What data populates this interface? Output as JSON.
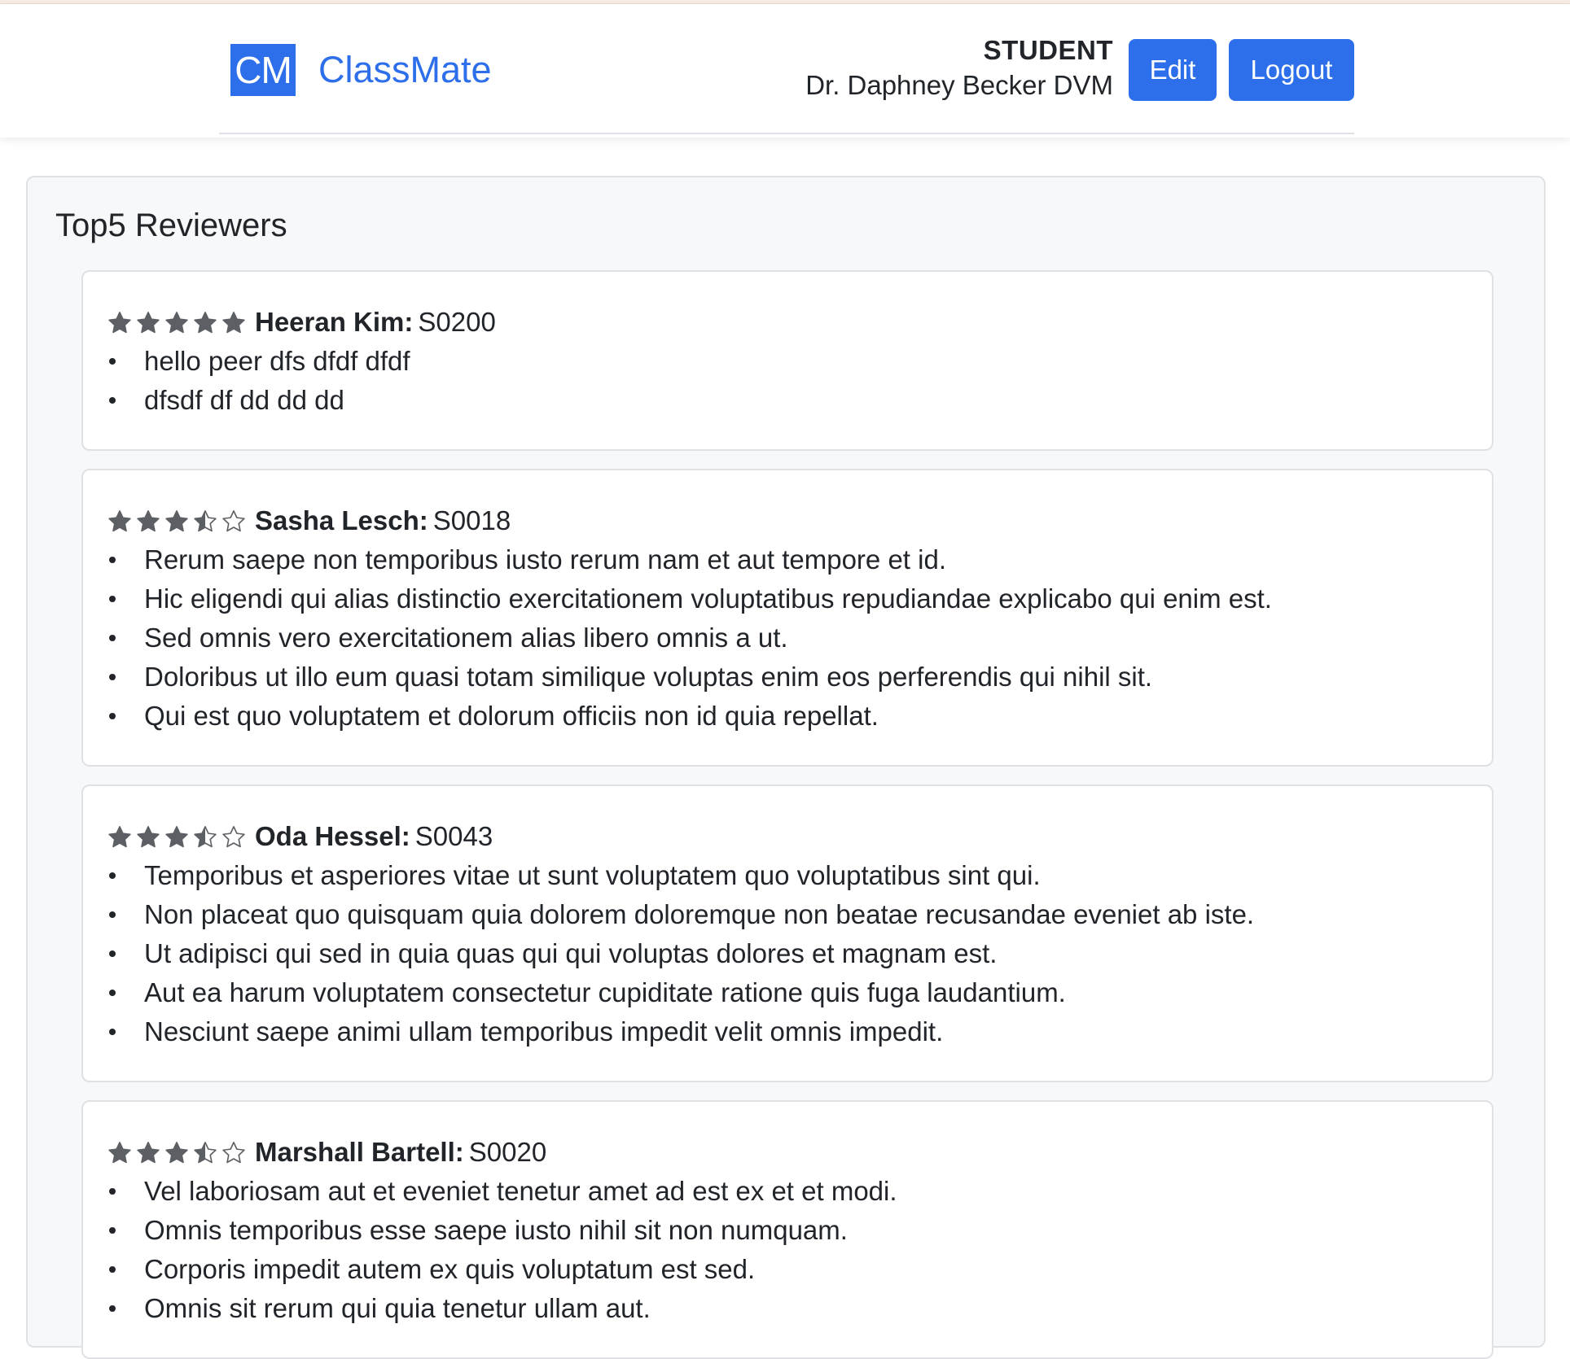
{
  "brand": {
    "logo": "CM",
    "name": "ClassMate"
  },
  "user": {
    "role": "STUDENT",
    "name": "Dr. Daphney Becker DVM"
  },
  "buttons": {
    "edit": "Edit",
    "logout": "Logout"
  },
  "colors": {
    "primary": "#2d6eea",
    "star": "#5c5f63"
  },
  "panel": {
    "title": "Top5 Reviewers"
  },
  "reviewers": [
    {
      "name": "Heeran Kim:",
      "id": "S0200",
      "rating": 5,
      "comments": [
        "hello peer dfs dfdf dfdf",
        "dfsdf df dd dd dd"
      ]
    },
    {
      "name": "Sasha Lesch:",
      "id": "S0018",
      "rating": 3.5,
      "comments": [
        "Rerum saepe non temporibus iusto rerum nam et aut tempore et id.",
        "Hic eligendi qui alias distinctio exercitationem voluptatibus repudiandae explicabo qui enim est.",
        "Sed omnis vero exercitationem alias libero omnis a ut.",
        "Doloribus ut illo eum quasi totam similique voluptas enim eos perferendis qui nihil sit.",
        "Qui est quo voluptatem et dolorum officiis non id quia repellat."
      ]
    },
    {
      "name": "Oda Hessel:",
      "id": "S0043",
      "rating": 3.5,
      "comments": [
        "Temporibus et asperiores vitae ut sunt voluptatem quo voluptatibus sint qui.",
        "Non placeat quo quisquam quia dolorem doloremque non beatae recusandae eveniet ab iste.",
        "Ut adipisci qui sed in quia quas qui qui voluptas dolores et magnam est.",
        "Aut ea harum voluptatem consectetur cupiditate ratione quis fuga laudantium.",
        "Nesciunt saepe animi ullam temporibus impedit velit omnis impedit."
      ]
    },
    {
      "name": "Marshall Bartell:",
      "id": "S0020",
      "rating": 3.5,
      "comments": [
        "Vel laboriosam aut et eveniet tenetur amet ad est ex et et modi.",
        "Omnis temporibus esse saepe iusto nihil sit non numquam.",
        "Corporis impedit autem ex quis voluptatum est sed.",
        "Omnis sit rerum qui quia tenetur ullam aut."
      ]
    }
  ]
}
